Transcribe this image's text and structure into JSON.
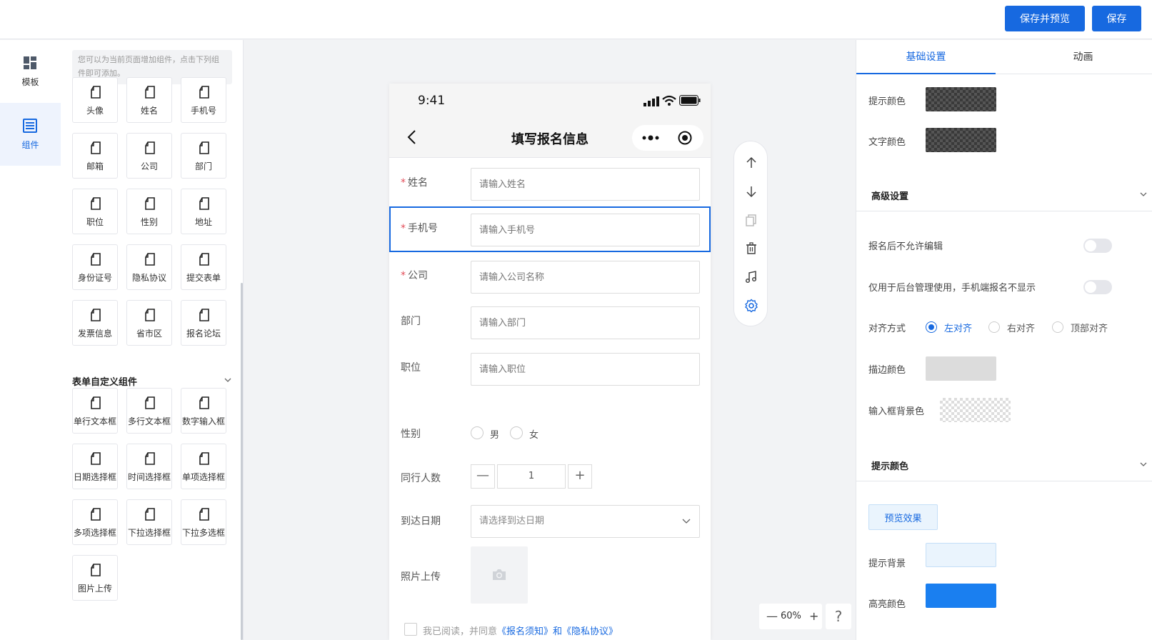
{
  "toolbar": {
    "save_preview_label": "保存并预览",
    "save_label": "保存"
  },
  "rail": {
    "items": [
      {
        "label": "模板",
        "icon": "template-icon",
        "active": false
      },
      {
        "label": "组件",
        "icon": "component-icon",
        "active": true
      }
    ]
  },
  "panel": {
    "hint": "您可以为当前页面增加组件，点击下列组件即可添加。",
    "basic_components": [
      "头像",
      "姓名",
      "手机号",
      "邮箱",
      "公司",
      "部门",
      "职位",
      "性别",
      "地址",
      "身份证号",
      "隐私协议",
      "提交表单",
      "发票信息",
      "省市区",
      "报名论坛"
    ],
    "custom_section_title": "表单自定义组件",
    "custom_components": [
      "单行文本框",
      "多行文本框",
      "数字输入框",
      "日期选择框",
      "时间选择框",
      "单项选择框",
      "多项选择框",
      "下拉选择框",
      "下拉多选框",
      "图片上传"
    ]
  },
  "phone": {
    "time": "9:41",
    "title": "填写报名信息",
    "fields": [
      {
        "label": "姓名",
        "required": true,
        "placeholder": "请输入姓名"
      },
      {
        "label": "手机号",
        "required": true,
        "placeholder": "请输入手机号"
      },
      {
        "label": "公司",
        "required": true,
        "placeholder": "请输入公司名称"
      },
      {
        "label": "部门",
        "required": false,
        "placeholder": "请输入部门"
      },
      {
        "label": "职位",
        "required": false,
        "placeholder": "请输入职位"
      }
    ],
    "gender": {
      "label": "性别",
      "options": [
        "男",
        "女"
      ]
    },
    "companions": {
      "label": "同行人数",
      "value": "1",
      "minus": "—",
      "plus": "+"
    },
    "arrival": {
      "label": "到达日期",
      "placeholder": "请选择到达日期"
    },
    "photo": {
      "label": "照片上传"
    },
    "agree": {
      "prefix": "我已阅读，并同意",
      "link1": "《报名须知》",
      "conj": "和",
      "link2": "《隐私协议》"
    }
  },
  "zoom": {
    "value": "60%",
    "minus": "—",
    "plus": "+"
  },
  "help": "?",
  "right": {
    "tabs": [
      "基础设置",
      "动画"
    ],
    "hint_color_label": "提示颜色",
    "text_color_label": "文字颜色",
    "advanced_title": "高级设置",
    "no_edit_label": "报名后不允许编辑",
    "admin_only_label": "仅用于后台管理使用，手机端报名不显示",
    "align_label": "对齐方式",
    "align_options": [
      "左对齐",
      "右对齐",
      "顶部对齐"
    ],
    "border_color_label": "描边颜色",
    "input_bg_label": "输入框背景色",
    "hint_section_title": "提示颜色",
    "preview_button": "预览效果",
    "hint_bg_label": "提示背景",
    "highlight_label": "高亮颜色",
    "colors": {
      "accent": "#1769e0",
      "border_swatch": "#dcdcdc",
      "hint_bg_swatch": "#eaf4fd",
      "highlight_swatch": "#1a7ff0",
      "required": "#e34d59"
    }
  }
}
